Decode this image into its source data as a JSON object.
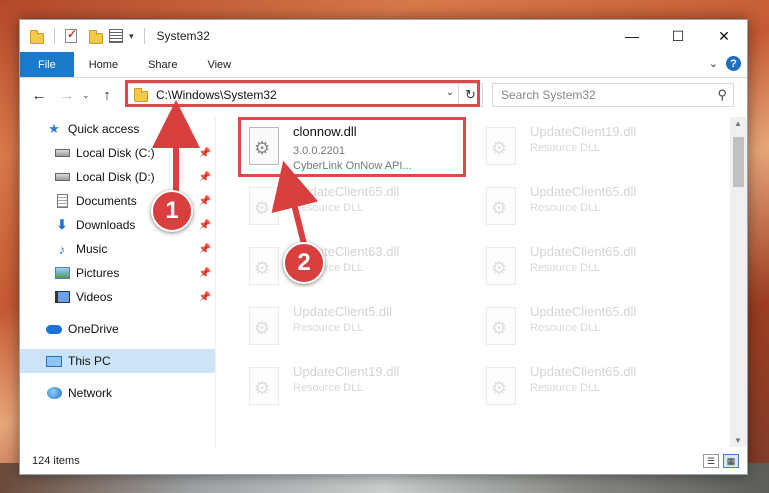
{
  "window": {
    "title": "System32",
    "caption": {
      "minimize": "—",
      "maximize": "☐",
      "close": "✕"
    }
  },
  "ribbon": {
    "tabs": [
      "File",
      "Home",
      "Share",
      "View"
    ],
    "help": "?"
  },
  "nav": {
    "address": "C:\\Windows\\System32",
    "search_placeholder": "Search System32"
  },
  "sidebar": {
    "items": [
      {
        "label": "Quick access",
        "icon": "star-icon"
      },
      {
        "label": "Local Disk (C:)",
        "icon": "drive-icon",
        "pinned": true
      },
      {
        "label": "Local Disk (D:)",
        "icon": "drive-icon",
        "pinned": true
      },
      {
        "label": "Documents",
        "icon": "document-icon",
        "pinned": true
      },
      {
        "label": "Downloads",
        "icon": "download-icon",
        "pinned": true
      },
      {
        "label": "Music",
        "icon": "music-icon",
        "pinned": true
      },
      {
        "label": "Pictures",
        "icon": "pictures-icon",
        "pinned": true
      },
      {
        "label": "Videos",
        "icon": "videos-icon",
        "pinned": true
      },
      {
        "label": "OneDrive",
        "icon": "cloud-icon"
      },
      {
        "label": "This PC",
        "icon": "pc-icon",
        "selected": true
      },
      {
        "label": "Network",
        "icon": "network-icon"
      }
    ]
  },
  "files": {
    "main": {
      "name": "clonnow.dll",
      "version": "3.0.0.2201",
      "description": "CyberLink OnNow API..."
    },
    "faded": [
      {
        "name": "UpdateClient19.dll",
        "type": "Resource DLL"
      },
      {
        "name": "UpdateClient65.dll",
        "type": "Resource DLL"
      },
      {
        "name": "UpdateClient65.dll",
        "type": "Resource DLL"
      },
      {
        "name": "UpdateClient63.dll",
        "type": "Resource DLL"
      },
      {
        "name": "UpdateClient65.dll",
        "type": "Resource DLL"
      },
      {
        "name": "UpdateClient5.dll",
        "type": "Resource DLL"
      },
      {
        "name": "UpdateClient65.dll",
        "type": "Resource DLL"
      },
      {
        "name": "UpdateClient19.dll",
        "type": "Resource DLL"
      },
      {
        "name": "UpdateClient65.dll",
        "type": "Resource DLL"
      }
    ]
  },
  "status": {
    "items_count": "124 items"
  },
  "annotations": {
    "badge1": "1",
    "badge2": "2",
    "color": "#d93f3f"
  }
}
